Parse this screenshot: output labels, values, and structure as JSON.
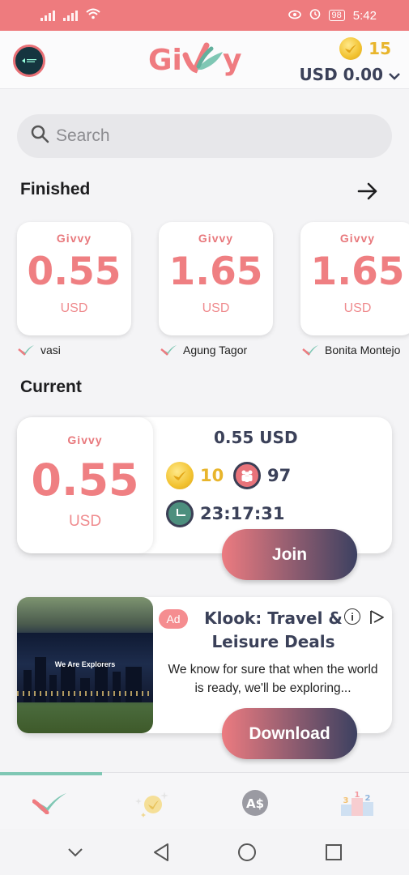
{
  "status_bar": {
    "battery": "98",
    "time": "5:42"
  },
  "header": {
    "logo_text": "Givvy",
    "coins": "15",
    "balance": "USD 0.00"
  },
  "search": {
    "placeholder": "Search"
  },
  "finished": {
    "title": "Finished",
    "cards": [
      {
        "brand": "Givvy",
        "amount": "0.55",
        "currency": "USD",
        "name": "vasi"
      },
      {
        "brand": "Givvy",
        "amount": "1.65",
        "currency": "USD",
        "name": "Agung Tagor"
      },
      {
        "brand": "Givvy",
        "amount": "1.65",
        "currency": "USD",
        "name": "Bonita Montejo"
      }
    ]
  },
  "current": {
    "title": "Current",
    "card": {
      "brand": "Givvy",
      "amount": "0.55",
      "currency": "USD",
      "prize": "0.55 USD",
      "coins": "10",
      "participants": "97",
      "timer": "23:17:31",
      "join_label": "Join"
    }
  },
  "ad": {
    "badge": "Ad",
    "title": "Klook: Travel & Leisure Deals",
    "description": "We know for sure that when the world is ready, we'll be exploring...",
    "image_caption": "We Are Explorers",
    "cta": "Download"
  },
  "tabs": [
    "home",
    "coins",
    "exchange",
    "leaderboard"
  ],
  "colors": {
    "accent_coral": "#ee7b7e",
    "accent_teal": "#7fc7b4",
    "navy": "#3b4159",
    "gold": "#e8b52c"
  }
}
